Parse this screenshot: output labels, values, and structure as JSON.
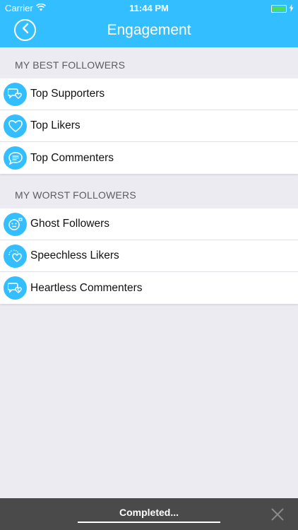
{
  "status_bar": {
    "carrier": "Carrier",
    "time": "11:44 PM"
  },
  "header": {
    "title": "Engagement",
    "back_icon": "chevron-left-icon",
    "color": "#33bfff"
  },
  "sections": [
    {
      "title": "MY BEST FOLLOWERS",
      "items": [
        {
          "label": "Top Supporters",
          "icon": "chat-heart-icon"
        },
        {
          "label": "Top Likers",
          "icon": "heart-icon"
        },
        {
          "label": "Top Commenters",
          "icon": "speech-bubble-icon"
        }
      ]
    },
    {
      "title": "MY WORST FOLLOWERS",
      "items": [
        {
          "label": "Ghost Followers",
          "icon": "ghost-face-icon"
        },
        {
          "label": "Speechless Likers",
          "icon": "dotted-heart-icon"
        },
        {
          "label": "Heartless Commenters",
          "icon": "broken-heart-chat-icon"
        }
      ]
    }
  ],
  "bottom_bar": {
    "status_text": "Completed...",
    "progress": 1.0,
    "close_icon": "close-icon"
  }
}
